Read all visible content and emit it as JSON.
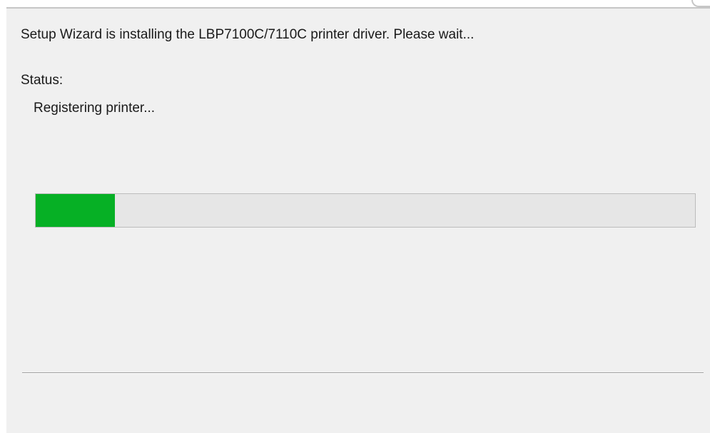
{
  "dialog": {
    "message": "Setup Wizard is installing the LBP7100C/7110C printer driver. Please wait...",
    "status_label": "Status:",
    "status_text": "Registering printer...",
    "progress": {
      "fraction": 0.12,
      "fill_color": "#06b025",
      "track_color": "#e6e6e6"
    }
  }
}
